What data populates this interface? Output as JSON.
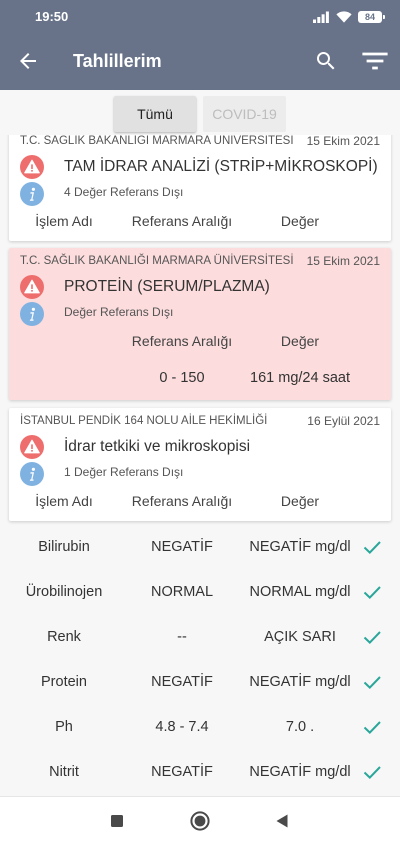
{
  "status_bar": {
    "time": "19:50",
    "battery": "84"
  },
  "toolbar": {
    "title": "Tahlillerim",
    "icons": {
      "back": "arrow-back-icon",
      "search": "search-icon",
      "filter": "filter-list-icon"
    }
  },
  "filter_tabs": [
    {
      "label": "Tümü",
      "selected": true
    },
    {
      "label": "COVID-19",
      "selected": false
    }
  ],
  "columns": {
    "name": "İşlem Adı",
    "range": "Referans Aralığı",
    "value": "Değer"
  },
  "results": [
    {
      "institution": "T.C. SAĞLIK BAKANLIĞI MARMARA ÜNİVERSİTESİ",
      "date": "15 Ekim 2021",
      "title": "TAM İDRAR ANALİZİ (STRİP+MİKROSKOPİ)",
      "status": "4 Değer Referans Dışı",
      "highlighted": false
    },
    {
      "institution": "T.C. SAĞLIK BAKANLIĞI MARMARA ÜNİVERSİTESİ",
      "date": "15 Ekim 2021",
      "title": "PROTEİN (SERUM/PLAZMA)",
      "status": "Değer Referans Dışı",
      "highlighted": true,
      "range": "0 - 150",
      "value": "161 mg/24 saat"
    },
    {
      "institution": "İSTANBUL PENDİK 164 NOLU AİLE HEKİMLİĞİ",
      "date": "16 Eylül 2021",
      "title": "İdrar tetkiki ve mikroskopisi",
      "status": "1 Değer Referans Dışı",
      "highlighted": false,
      "expanded": true,
      "items": [
        {
          "name": "Bilirubin",
          "range": "NEGATİF",
          "value": "NEGATİF mg/dl",
          "in_range": true
        },
        {
          "name": "Ürobilinojen",
          "range": "NORMAL",
          "value": "NORMAL mg/dl",
          "in_range": true
        },
        {
          "name": "Renk",
          "range": "--",
          "value": "AÇIK SARI",
          "in_range": true
        },
        {
          "name": "Protein",
          "range": "NEGATİF",
          "value": "NEGATİF mg/dl",
          "in_range": true
        },
        {
          "name": "Ph",
          "range": "4.8 - 7.4",
          "value": "7.0 .",
          "in_range": true
        },
        {
          "name": "Nitrit",
          "range": "NEGATİF",
          "value": "NEGATİF mg/dl",
          "in_range": true
        }
      ]
    }
  ],
  "system_nav": {
    "icons": [
      "recent-apps-icon",
      "home-icon",
      "back-triangle-icon"
    ]
  },
  "colors": {
    "header": "#687389",
    "warning": "#ee6e6e",
    "info": "#80b2e1",
    "check": "#2aa79b",
    "highlight": "#fcdcdc"
  }
}
